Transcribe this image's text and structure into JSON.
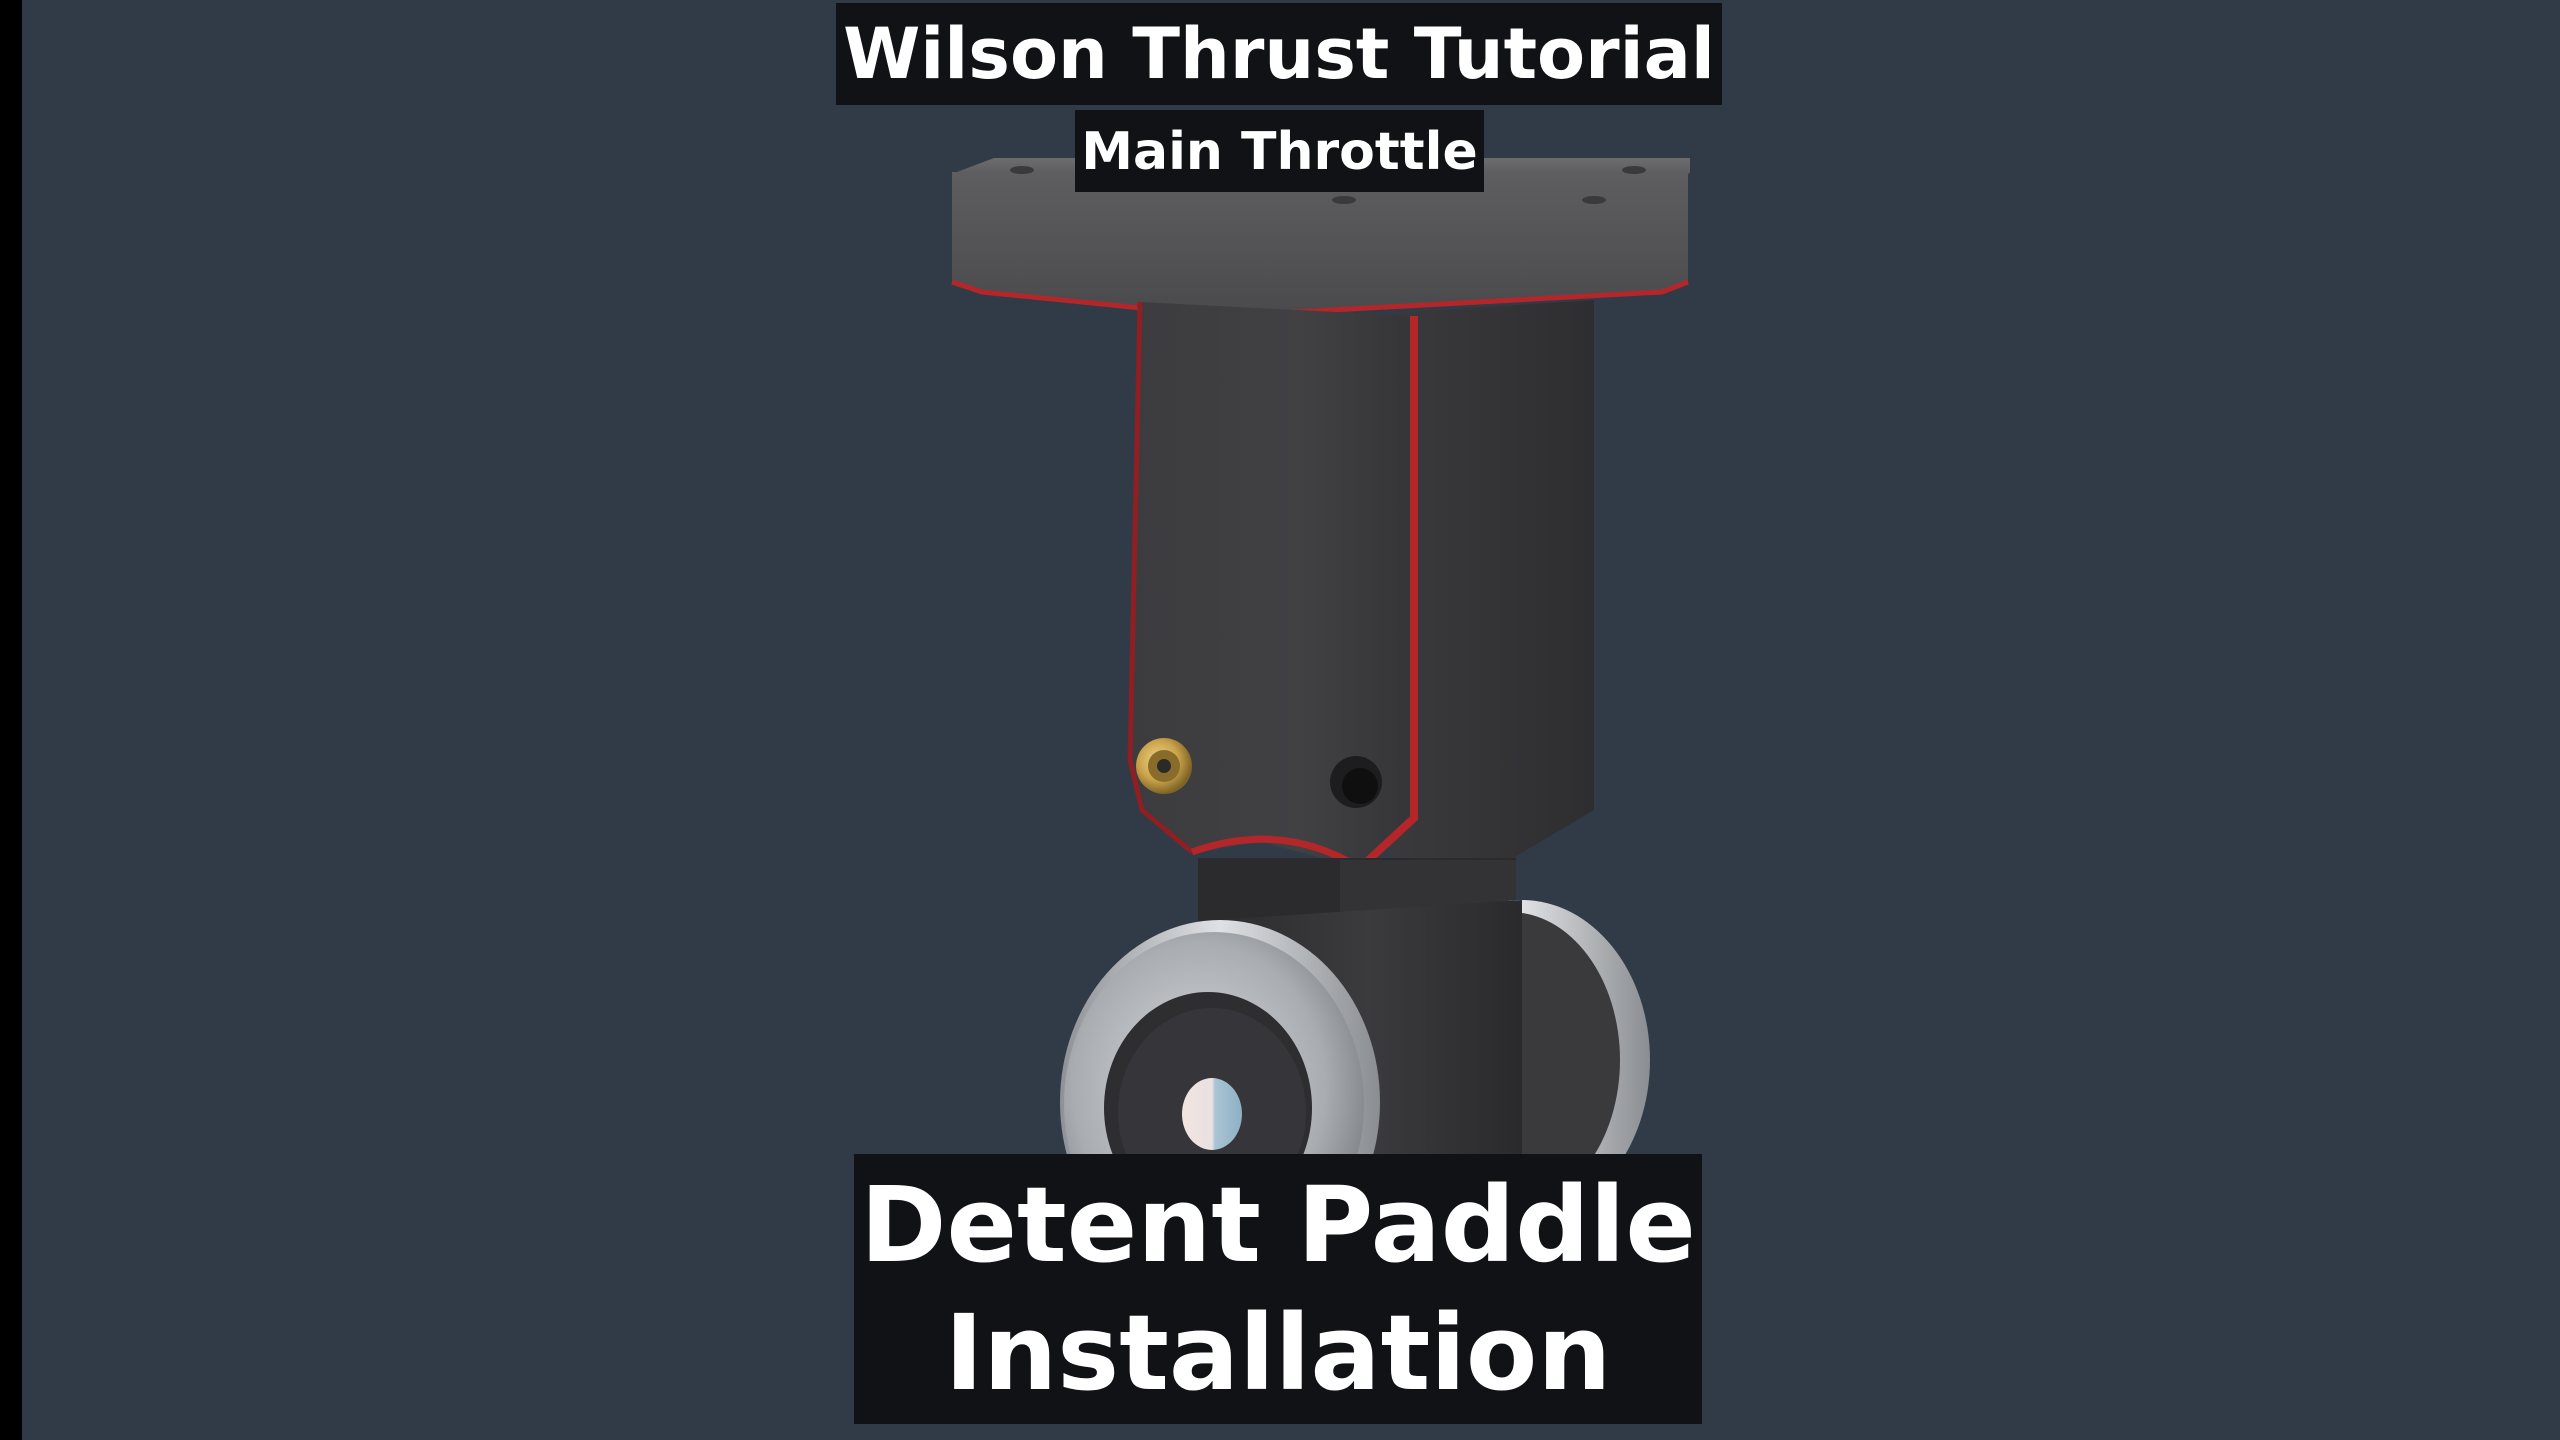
{
  "video": {
    "series_title": "Wilson Thrust Tutorial",
    "subtitle": "Main Throttle",
    "topic_line1": "Detent Paddle",
    "topic_line2": "Installation"
  },
  "colors": {
    "background": "#313b48",
    "caption_bg": "#101216",
    "caption_text": "#ffffff",
    "part_body": "#3a3a3c",
    "edge_highlight": "#b3262a",
    "brass_insert": "#c9a24a",
    "metal_wheel": "#bfc2c6"
  }
}
